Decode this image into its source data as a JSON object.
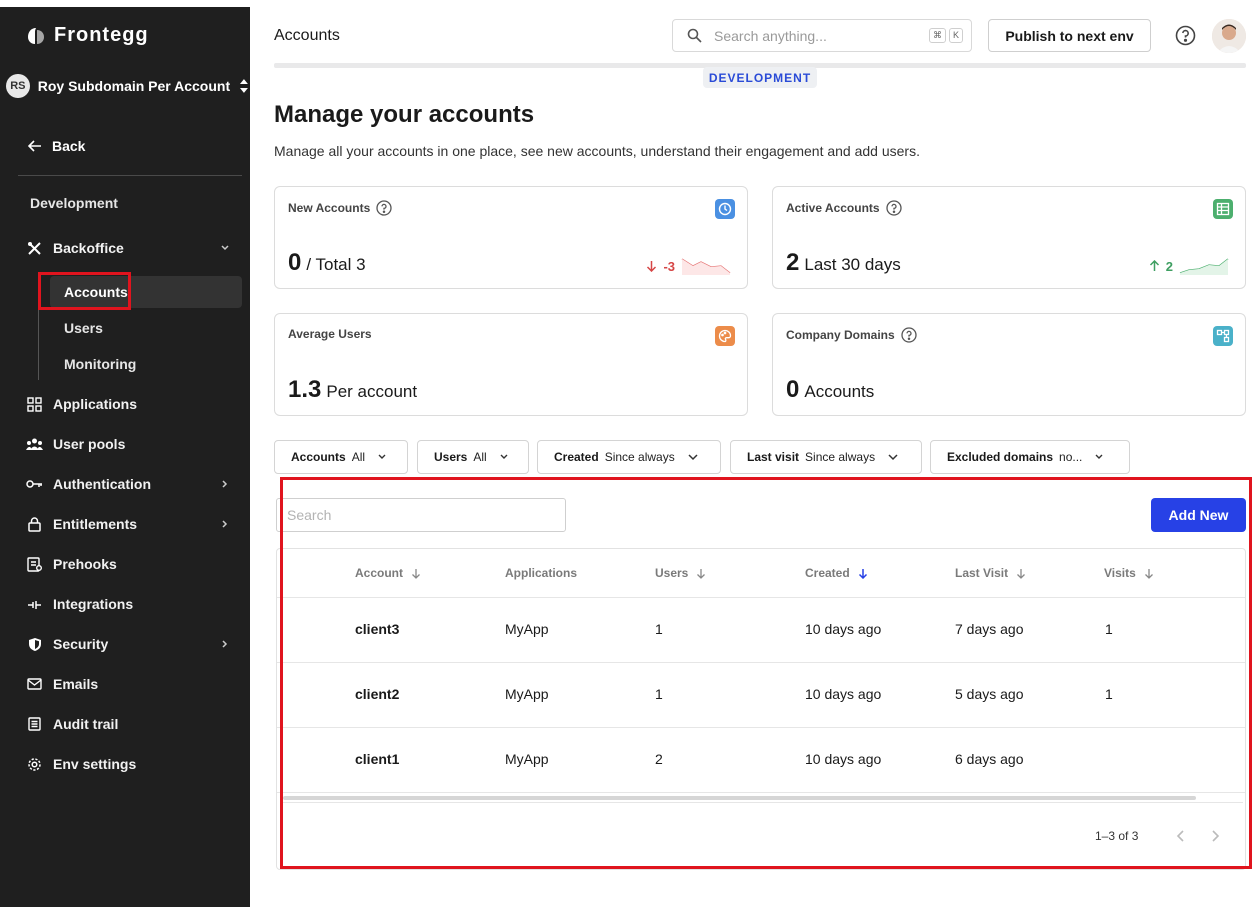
{
  "brand": {
    "name": "Frontegg"
  },
  "workspace": {
    "initials": "RS",
    "name": "Roy Subdomain Per Account"
  },
  "sidebar": {
    "back_label": "Back",
    "env_label": "Development",
    "backoffice": {
      "label": "Backoffice",
      "children": [
        {
          "label": "Accounts",
          "active": true
        },
        {
          "label": "Users"
        },
        {
          "label": "Monitoring"
        }
      ]
    },
    "items": [
      {
        "label": "Applications",
        "icon": "applications-icon"
      },
      {
        "label": "User pools",
        "icon": "user-pools-icon"
      },
      {
        "label": "Authentication",
        "icon": "key-icon",
        "expandable": true
      },
      {
        "label": "Entitlements",
        "icon": "lock-icon",
        "expandable": true
      },
      {
        "label": "Prehooks",
        "icon": "prehooks-icon"
      },
      {
        "label": "Integrations",
        "icon": "integrations-icon"
      },
      {
        "label": "Security",
        "icon": "shield-icon",
        "expandable": true
      },
      {
        "label": "Emails",
        "icon": "mail-icon"
      },
      {
        "label": "Audit trail",
        "icon": "audit-icon"
      },
      {
        "label": "Env settings",
        "icon": "gear-icon"
      }
    ]
  },
  "header": {
    "title": "Accounts",
    "search_placeholder": "Search anything...",
    "shortcut_keys": [
      "⌘",
      "K"
    ],
    "publish_label": "Publish to next env",
    "env_badge": "DEVELOPMENT"
  },
  "main": {
    "title": "Manage your accounts",
    "subtitle": "Manage all your accounts in one place, see new accounts, understand their engagement and add users.",
    "cards": [
      {
        "title": "New Accounts",
        "big": "0",
        "rest": "/ Total 3",
        "trend": "-3",
        "trend_dir": "down",
        "icon_color": "#4a90e2"
      },
      {
        "title": "Active Accounts",
        "big": "2",
        "rest": "Last 30 days",
        "trend": "2",
        "trend_dir": "up",
        "icon_color": "#4caf6e"
      },
      {
        "title": "Average Users",
        "big": "1.3",
        "rest": "Per account",
        "icon_color": "#ec8c4a"
      },
      {
        "title": "Company Domains",
        "big": "0",
        "rest": "Accounts",
        "icon_color": "#4ab1c9"
      }
    ],
    "filters": [
      {
        "key": "Accounts",
        "value": "All"
      },
      {
        "key": "Users",
        "value": "All"
      },
      {
        "key": "Created",
        "value": "Since always"
      },
      {
        "key": "Last visit",
        "value": "Since always"
      },
      {
        "key": "Excluded domains",
        "value": "no..."
      }
    ],
    "table": {
      "search_placeholder": "Search",
      "add_label": "Add New",
      "columns": [
        "Account",
        "Applications",
        "Users",
        "Created",
        "Last Visit",
        "Visits"
      ],
      "rows": [
        {
          "account": "client3",
          "applications": "MyApp",
          "users": "1",
          "created": "10 days ago",
          "last_visit": "7 days ago",
          "visits": "1"
        },
        {
          "account": "client2",
          "applications": "MyApp",
          "users": "1",
          "created": "10 days ago",
          "last_visit": "5 days ago",
          "visits": "1"
        },
        {
          "account": "client1",
          "applications": "MyApp",
          "users": "2",
          "created": "10 days ago",
          "last_visit": "6 days ago",
          "visits": ""
        }
      ],
      "pagination": "1–3 of 3"
    }
  },
  "colors": {
    "accent": "#2741e6",
    "highlight": "#e0141e",
    "sidebar_bg": "#1f1f1f"
  }
}
